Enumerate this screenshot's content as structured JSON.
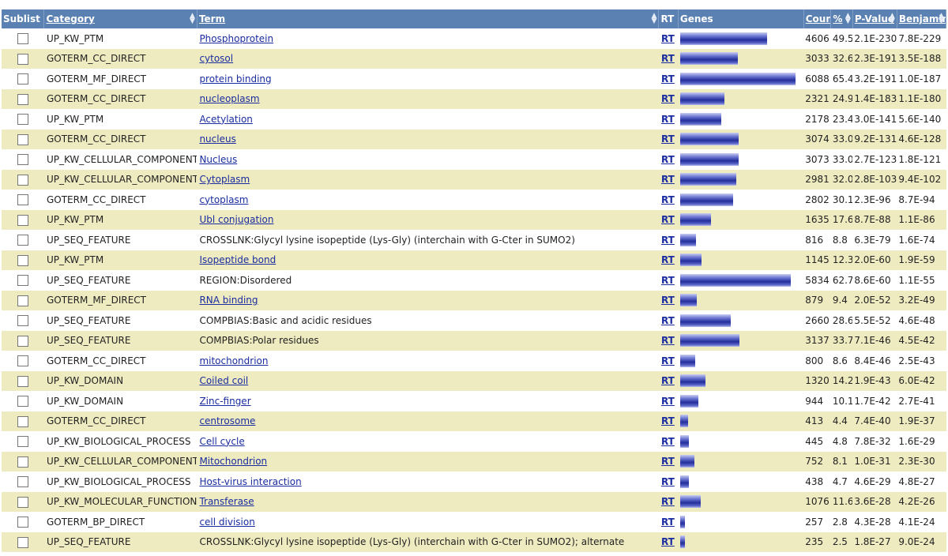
{
  "header": {
    "sublist": "Sublist",
    "category": "Category",
    "term": "Term",
    "rt": "RT",
    "genes": "Genes",
    "count": "Count",
    "percent": "%",
    "pvalue": "P-Value",
    "benjamini": "Benjamini"
  },
  "rt_label": "RT",
  "max_count": 6088,
  "rows": [
    {
      "category": "UP_KW_PTM",
      "term": "Phosphoprotein",
      "link": true,
      "count": "4606",
      "percent": "49.5",
      "pvalue": "2.1E-230",
      "benjamini": "7.8E-229"
    },
    {
      "category": "GOTERM_CC_DIRECT",
      "term": "cytosol",
      "link": true,
      "count": "3033",
      "percent": "32.6",
      "pvalue": "2.3E-191",
      "benjamini": "3.5E-188"
    },
    {
      "category": "GOTERM_MF_DIRECT",
      "term": "protein binding",
      "link": true,
      "count": "6088",
      "percent": "65.4",
      "pvalue": "3.2E-191",
      "benjamini": "1.0E-187"
    },
    {
      "category": "GOTERM_CC_DIRECT",
      "term": "nucleoplasm",
      "link": true,
      "count": "2321",
      "percent": "24.9",
      "pvalue": "1.4E-183",
      "benjamini": "1.1E-180"
    },
    {
      "category": "UP_KW_PTM",
      "term": "Acetylation",
      "link": true,
      "count": "2178",
      "percent": "23.4",
      "pvalue": "3.0E-141",
      "benjamini": "5.6E-140"
    },
    {
      "category": "GOTERM_CC_DIRECT",
      "term": "nucleus",
      "link": true,
      "count": "3074",
      "percent": "33.0",
      "pvalue": "9.2E-131",
      "benjamini": "4.6E-128"
    },
    {
      "category": "UP_KW_CELLULAR_COMPONENT",
      "term": "Nucleus",
      "link": true,
      "count": "3073",
      "percent": "33.0",
      "pvalue": "2.7E-123",
      "benjamini": "1.8E-121"
    },
    {
      "category": "UP_KW_CELLULAR_COMPONENT",
      "term": "Cytoplasm",
      "link": true,
      "count": "2981",
      "percent": "32.0",
      "pvalue": "2.8E-103",
      "benjamini": "9.4E-102"
    },
    {
      "category": "GOTERM_CC_DIRECT",
      "term": "cytoplasm",
      "link": true,
      "count": "2802",
      "percent": "30.1",
      "pvalue": "2.3E-96",
      "benjamini": "8.7E-94"
    },
    {
      "category": "UP_KW_PTM",
      "term": "Ubl conjugation",
      "link": true,
      "count": "1635",
      "percent": "17.6",
      "pvalue": "8.7E-88",
      "benjamini": "1.1E-86"
    },
    {
      "category": "UP_SEQ_FEATURE",
      "term": "CROSSLNK:Glycyl lysine isopeptide (Lys-Gly) (interchain with G-Cter in SUMO2)",
      "link": false,
      "count": "816",
      "percent": "8.8",
      "pvalue": "6.3E-79",
      "benjamini": "1.6E-74"
    },
    {
      "category": "UP_KW_PTM",
      "term": "Isopeptide bond",
      "link": true,
      "count": "1145",
      "percent": "12.3",
      "pvalue": "2.0E-60",
      "benjamini": "1.9E-59"
    },
    {
      "category": "UP_SEQ_FEATURE",
      "term": "REGION:Disordered",
      "link": false,
      "count": "5834",
      "percent": "62.7",
      "pvalue": "8.6E-60",
      "benjamini": "1.1E-55"
    },
    {
      "category": "GOTERM_MF_DIRECT",
      "term": "RNA binding",
      "link": true,
      "count": "879",
      "percent": "9.4",
      "pvalue": "2.0E-52",
      "benjamini": "3.2E-49"
    },
    {
      "category": "UP_SEQ_FEATURE",
      "term": "COMPBIAS:Basic and acidic residues",
      "link": false,
      "count": "2660",
      "percent": "28.6",
      "pvalue": "5.5E-52",
      "benjamini": "4.6E-48"
    },
    {
      "category": "UP_SEQ_FEATURE",
      "term": "COMPBIAS:Polar residues",
      "link": false,
      "count": "3137",
      "percent": "33.7",
      "pvalue": "7.1E-46",
      "benjamini": "4.5E-42"
    },
    {
      "category": "GOTERM_CC_DIRECT",
      "term": "mitochondrion",
      "link": true,
      "count": "800",
      "percent": "8.6",
      "pvalue": "8.4E-46",
      "benjamini": "2.5E-43"
    },
    {
      "category": "UP_KW_DOMAIN",
      "term": "Coiled coil",
      "link": true,
      "count": "1320",
      "percent": "14.2",
      "pvalue": "1.9E-43",
      "benjamini": "6.0E-42"
    },
    {
      "category": "UP_KW_DOMAIN",
      "term": "Zinc-finger",
      "link": true,
      "count": "944",
      "percent": "10.1",
      "pvalue": "1.7E-42",
      "benjamini": "2.7E-41"
    },
    {
      "category": "GOTERM_CC_DIRECT",
      "term": "centrosome",
      "link": true,
      "count": "413",
      "percent": "4.4",
      "pvalue": "7.4E-40",
      "benjamini": "1.9E-37"
    },
    {
      "category": "UP_KW_BIOLOGICAL_PROCESS",
      "term": "Cell cycle",
      "link": true,
      "count": "445",
      "percent": "4.8",
      "pvalue": "7.8E-32",
      "benjamini": "1.6E-29"
    },
    {
      "category": "UP_KW_CELLULAR_COMPONENT",
      "term": "Mitochondrion",
      "link": true,
      "count": "752",
      "percent": "8.1",
      "pvalue": "1.0E-31",
      "benjamini": "2.3E-30"
    },
    {
      "category": "UP_KW_BIOLOGICAL_PROCESS",
      "term": "Host-virus interaction",
      "link": true,
      "count": "438",
      "percent": "4.7",
      "pvalue": "4.6E-29",
      "benjamini": "4.8E-27"
    },
    {
      "category": "UP_KW_MOLECULAR_FUNCTION",
      "term": "Transferase",
      "link": true,
      "count": "1076",
      "percent": "11.6",
      "pvalue": "3.6E-28",
      "benjamini": "4.2E-26"
    },
    {
      "category": "GOTERM_BP_DIRECT",
      "term": "cell division",
      "link": true,
      "count": "257",
      "percent": "2.8",
      "pvalue": "4.3E-28",
      "benjamini": "4.1E-24"
    },
    {
      "category": "UP_SEQ_FEATURE",
      "term": "CROSSLNK:Glycyl lysine isopeptide (Lys-Gly) (interchain with G-Cter in SUMO2); alternate",
      "link": false,
      "count": "235",
      "percent": "2.5",
      "pvalue": "1.8E-27",
      "benjamini": "9.0E-24"
    }
  ]
}
